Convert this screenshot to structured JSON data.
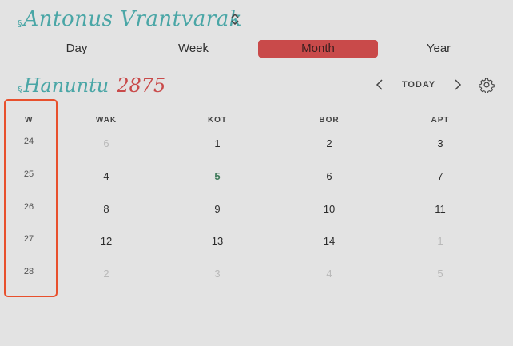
{
  "calendar": {
    "section_mark": "§",
    "title": "Antonus Vrantvarak"
  },
  "views": [
    "Day",
    "Week",
    "Month",
    "Year"
  ],
  "active_view": "Month",
  "month": {
    "section_mark": "§",
    "name": "Hanuntu",
    "year": "2875"
  },
  "nav": {
    "today": "TODAY"
  },
  "grid": {
    "week_header": "W",
    "day_headers": [
      "WAK",
      "KOT",
      "BOR",
      "APT"
    ],
    "weeks": [
      {
        "week": "24",
        "days": [
          {
            "d": "6",
            "muted": true
          },
          {
            "d": "1"
          },
          {
            "d": "2"
          },
          {
            "d": "3"
          }
        ]
      },
      {
        "week": "25",
        "days": [
          {
            "d": "4"
          },
          {
            "d": "5",
            "today": true
          },
          {
            "d": "6"
          },
          {
            "d": "7"
          }
        ]
      },
      {
        "week": "26",
        "days": [
          {
            "d": "8"
          },
          {
            "d": "9"
          },
          {
            "d": "10"
          },
          {
            "d": "11"
          }
        ]
      },
      {
        "week": "27",
        "days": [
          {
            "d": "12"
          },
          {
            "d": "13"
          },
          {
            "d": "14"
          },
          {
            "d": "1",
            "muted": true
          }
        ]
      },
      {
        "week": "28",
        "days": [
          {
            "d": "2",
            "muted": true
          },
          {
            "d": "3",
            "muted": true
          },
          {
            "d": "4",
            "muted": true
          },
          {
            "d": "5",
            "muted": true
          }
        ]
      }
    ]
  },
  "colors": {
    "accent_teal": "#4aa6a6",
    "accent_red": "#c94a4a",
    "highlight_box": "#e8502d",
    "today_green": "#3f7a5a"
  }
}
